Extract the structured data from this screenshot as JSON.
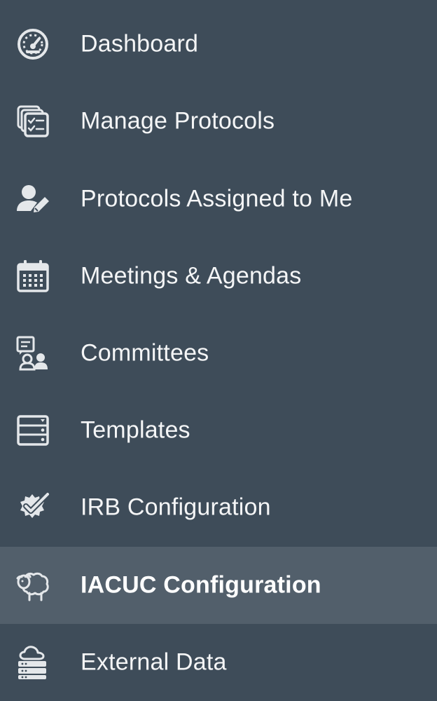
{
  "nav": {
    "items": [
      {
        "label": "Dashboard",
        "icon": "dashboard-gauge-icon",
        "active": false
      },
      {
        "label": "Manage Protocols",
        "icon": "manage-protocols-icon",
        "active": false
      },
      {
        "label": "Protocols Assigned to Me",
        "icon": "user-edit-icon",
        "active": false
      },
      {
        "label": "Meetings & Agendas",
        "icon": "calendar-icon",
        "active": false
      },
      {
        "label": "Committees",
        "icon": "committee-icon",
        "active": false
      },
      {
        "label": "Templates",
        "icon": "templates-icon",
        "active": false
      },
      {
        "label": "IRB Configuration",
        "icon": "badge-check-icon",
        "active": false
      },
      {
        "label": "IACUC Configuration",
        "icon": "sheep-icon",
        "active": true
      },
      {
        "label": "External Data",
        "icon": "cloud-server-icon",
        "active": false
      }
    ]
  },
  "colors": {
    "background": "#3e4c59",
    "active_background": "#525f6b",
    "text": "#f4f5f6",
    "icon": "#e4e7ea"
  }
}
